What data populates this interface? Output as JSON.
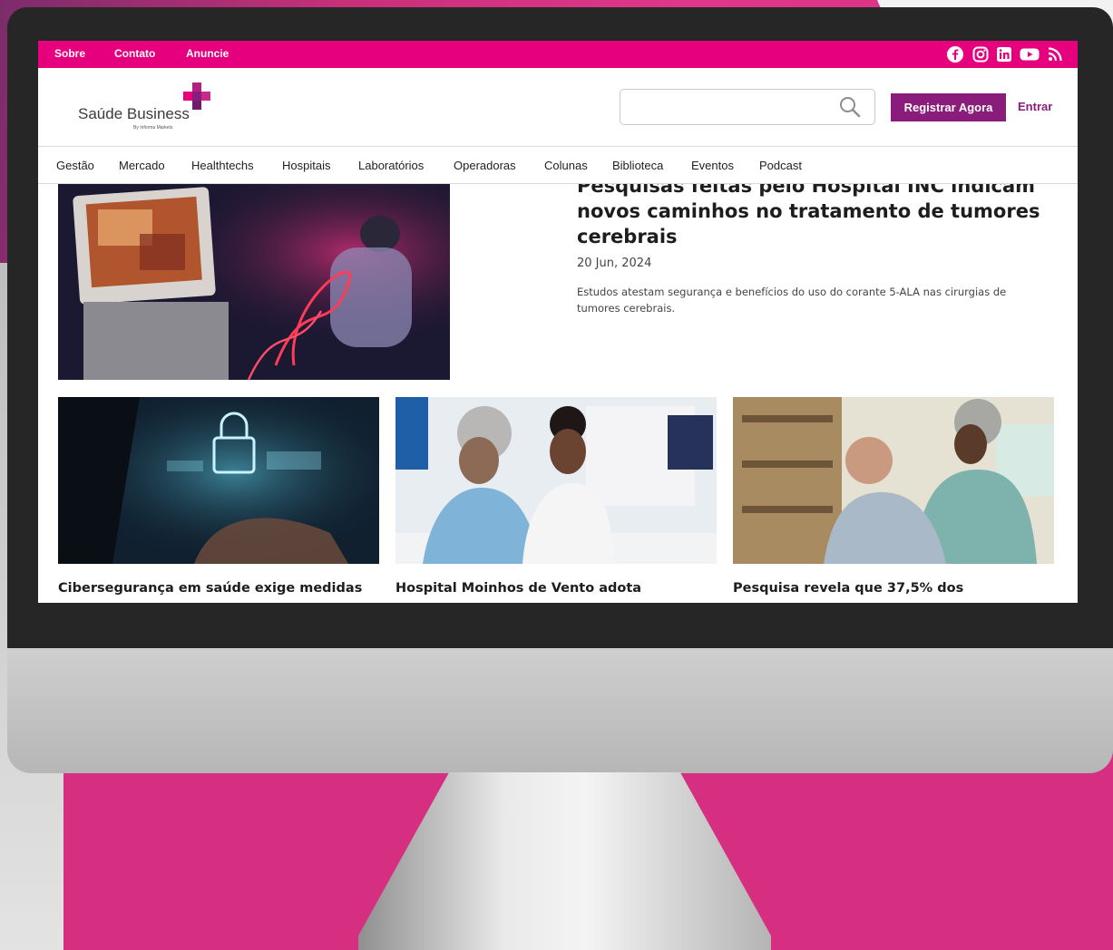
{
  "topbar": {
    "links": [
      "Sobre",
      "Contato",
      "Anuncie"
    ],
    "social_icons": [
      "facebook-icon",
      "instagram-icon",
      "linkedin-icon",
      "youtube-icon",
      "rss-icon"
    ],
    "bg_color": "#e6007e"
  },
  "header": {
    "logo_text": "Saúde Business",
    "logo_subtext": "By Informa Markets",
    "search_value": "",
    "register_label": "Registrar Agora",
    "login_label": "Entrar",
    "accent_color": "#8a1c7c"
  },
  "nav": {
    "items": [
      "Gestão",
      "Mercado",
      "Healthtechs",
      "Hospitais",
      "Laboratórios",
      "Operadoras",
      "Colunas",
      "Biblioteca",
      "Eventos",
      "Podcast"
    ]
  },
  "hero": {
    "title": "Pesquisas feitas pelo Hospital INC indicam novos caminhos no tratamento de tumores cerebrais",
    "date": "20 Jun, 2024",
    "description": "Estudos atestam segurança e benefícios do uso do corante 5-ALA nas cirurgias de tumores cerebrais."
  },
  "cards": [
    {
      "title": "Cibersegurança em saúde exige medidas"
    },
    {
      "title": "Hospital Moinhos de Vento adota"
    },
    {
      "title": "Pesquisa revela que 37,5% dos"
    }
  ]
}
